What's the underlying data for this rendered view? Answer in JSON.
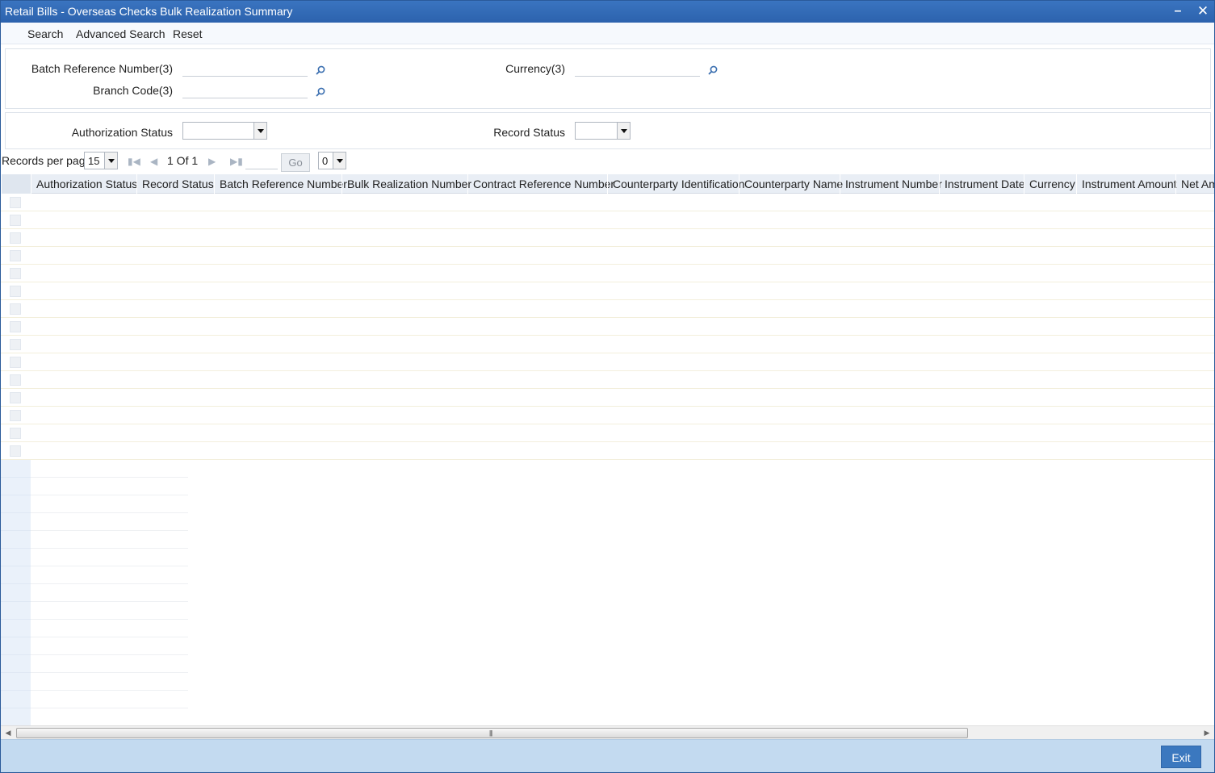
{
  "window": {
    "title": "Retail Bills - Overseas Checks Bulk Realization Summary"
  },
  "toolbar": {
    "search": "Search",
    "advanced_search": "Advanced Search",
    "reset": "Reset"
  },
  "criteria": {
    "batch_reference_label": "Batch Reference Number(3)",
    "branch_code_label": "Branch Code(3)",
    "currency_label": "Currency(3)",
    "authorization_status_label": "Authorization Status",
    "record_status_label": "Record Status",
    "batch_reference_value": "",
    "branch_code_value": "",
    "currency_value": "",
    "authorization_status_value": "",
    "record_status_value": ""
  },
  "pager": {
    "records_per_page_label": "Records per page",
    "records_per_page_value": "15",
    "page_info": "1 Of 1",
    "go_label": "Go",
    "extra_select_value": "0"
  },
  "grid": {
    "columns": [
      "Authorization Status",
      "Record Status",
      "Batch Reference Number",
      "Bulk Realization Number",
      "Contract Reference Number",
      "Counterparty Identification",
      "Counterparty Name",
      "Instrument Number",
      "Instrument Date",
      "Currency",
      "Instrument Amount",
      "Net Am"
    ]
  },
  "footer": {
    "exit_label": "Exit"
  },
  "icons": {
    "minimize": "minimize-icon",
    "close": "close-icon",
    "lookup": "search-icon"
  },
  "colors": {
    "titlebar": "#2c62ad",
    "footer": "#c3daf0",
    "exit_button": "#3b78bf"
  }
}
